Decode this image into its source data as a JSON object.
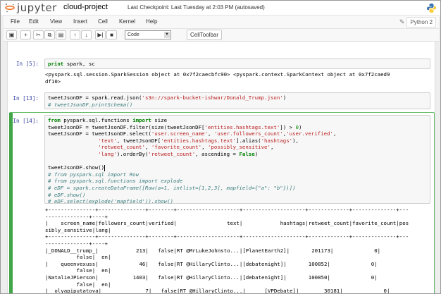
{
  "header": {
    "logo_text": "jupyter",
    "notebook_name": "cloud-project",
    "checkpoint": "Last Checkpoint: Last Tuesday at 2:03 PM (autosaved)"
  },
  "menu": [
    "File",
    "Edit",
    "View",
    "Insert",
    "Cell",
    "Kernel",
    "Help"
  ],
  "kernel": "Python 2",
  "toolbar": {
    "buttons": [
      "save-icon",
      "add-icon",
      "cut-icon",
      "copy-icon",
      "paste-icon",
      "move-up-icon",
      "move-down-icon",
      "run-icon",
      "stop-icon",
      "restart-icon"
    ],
    "cell_type": "Code",
    "celltoolbar_label": "CellToolbar"
  },
  "cells": {
    "c5": {
      "prompt": "In [5]:",
      "code": "print spark, sc",
      "output": "<pyspark.sql.session.SparkSession object at 0x7f2caecbfc90> <pyspark.context.SparkContext object at 0x7f2caed9\ndf10>"
    },
    "c13": {
      "prompt": "In [13]:",
      "line1_a": "tweetJsonDF = spark.read.json(",
      "line1_str": "'s3n://spark-bucket-ishwar/Donald_Trump.json'",
      "line1_b": ")",
      "line2": "# tweetJsonDF.printSchema()"
    },
    "c14": {
      "prompt": "In [14]:",
      "output": "+---------------+---------------+--------+--------------------+--------------------+-------------+--------------+---\n--------------+----+\n|    screen_name|followers_count|verified|                text|            hashtags|retweet_count|favorite_count|pos\nsibly_sensitive|lang|\n+---------------+---------------+--------+--------------------+--------------------+-------------+--------------+---\n--------------+----+\n|_DONALD__trump_|            213|   false|RT @MrLukeJohnsto...|[PlanetEarth2]|       201173|             0|\n          false|  en|\n|    queenvexuss|             46|   false|RT @HillaryClinto...|[debatenight]|       100852|             0|\n          false|  en|\n|NatalieJPierson|           1403|   false|RT @HillaryClinto...|[debatenight]|       100850|             0|\n          false|  en|\n|  olyapiputatova|              7|   false|RT @HillaryClinto...|      [VPDebate]|        30181|             0|\n          false|  en|"
    }
  }
}
